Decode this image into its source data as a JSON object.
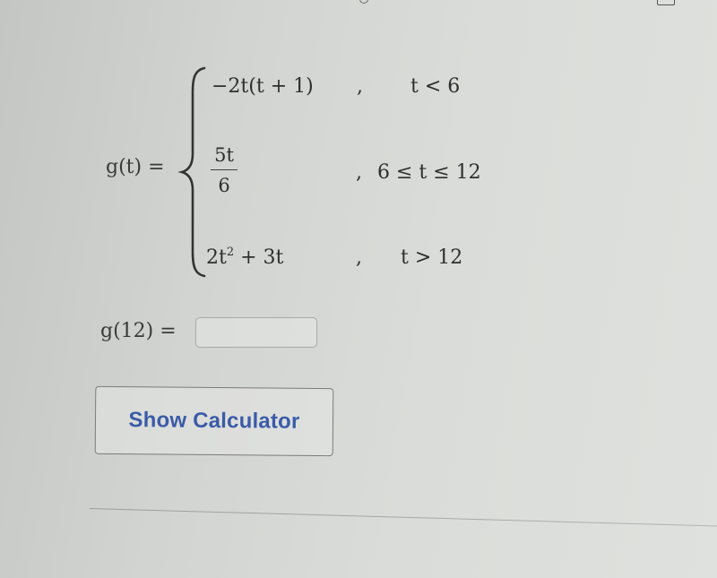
{
  "function": {
    "lhs": "g(t) =",
    "pieces": [
      {
        "expression": "−2t(t + 1)",
        "separator": ",",
        "condition": "t < 6"
      },
      {
        "expression_numerator": "5t",
        "expression_denominator": "6",
        "separator": ",",
        "condition": "6 ≤ t ≤ 12"
      },
      {
        "expression_base": "2t",
        "expression_exponent": "2",
        "expression_rest": " + 3t",
        "separator": ",",
        "condition": "t > 12"
      }
    ]
  },
  "answer": {
    "label": "g(12) =",
    "value": "",
    "placeholder": ""
  },
  "calculator_button": {
    "label": "Show Calculator"
  },
  "colors": {
    "button_text": "#3a5ba8",
    "background": "#d6d8d5"
  }
}
